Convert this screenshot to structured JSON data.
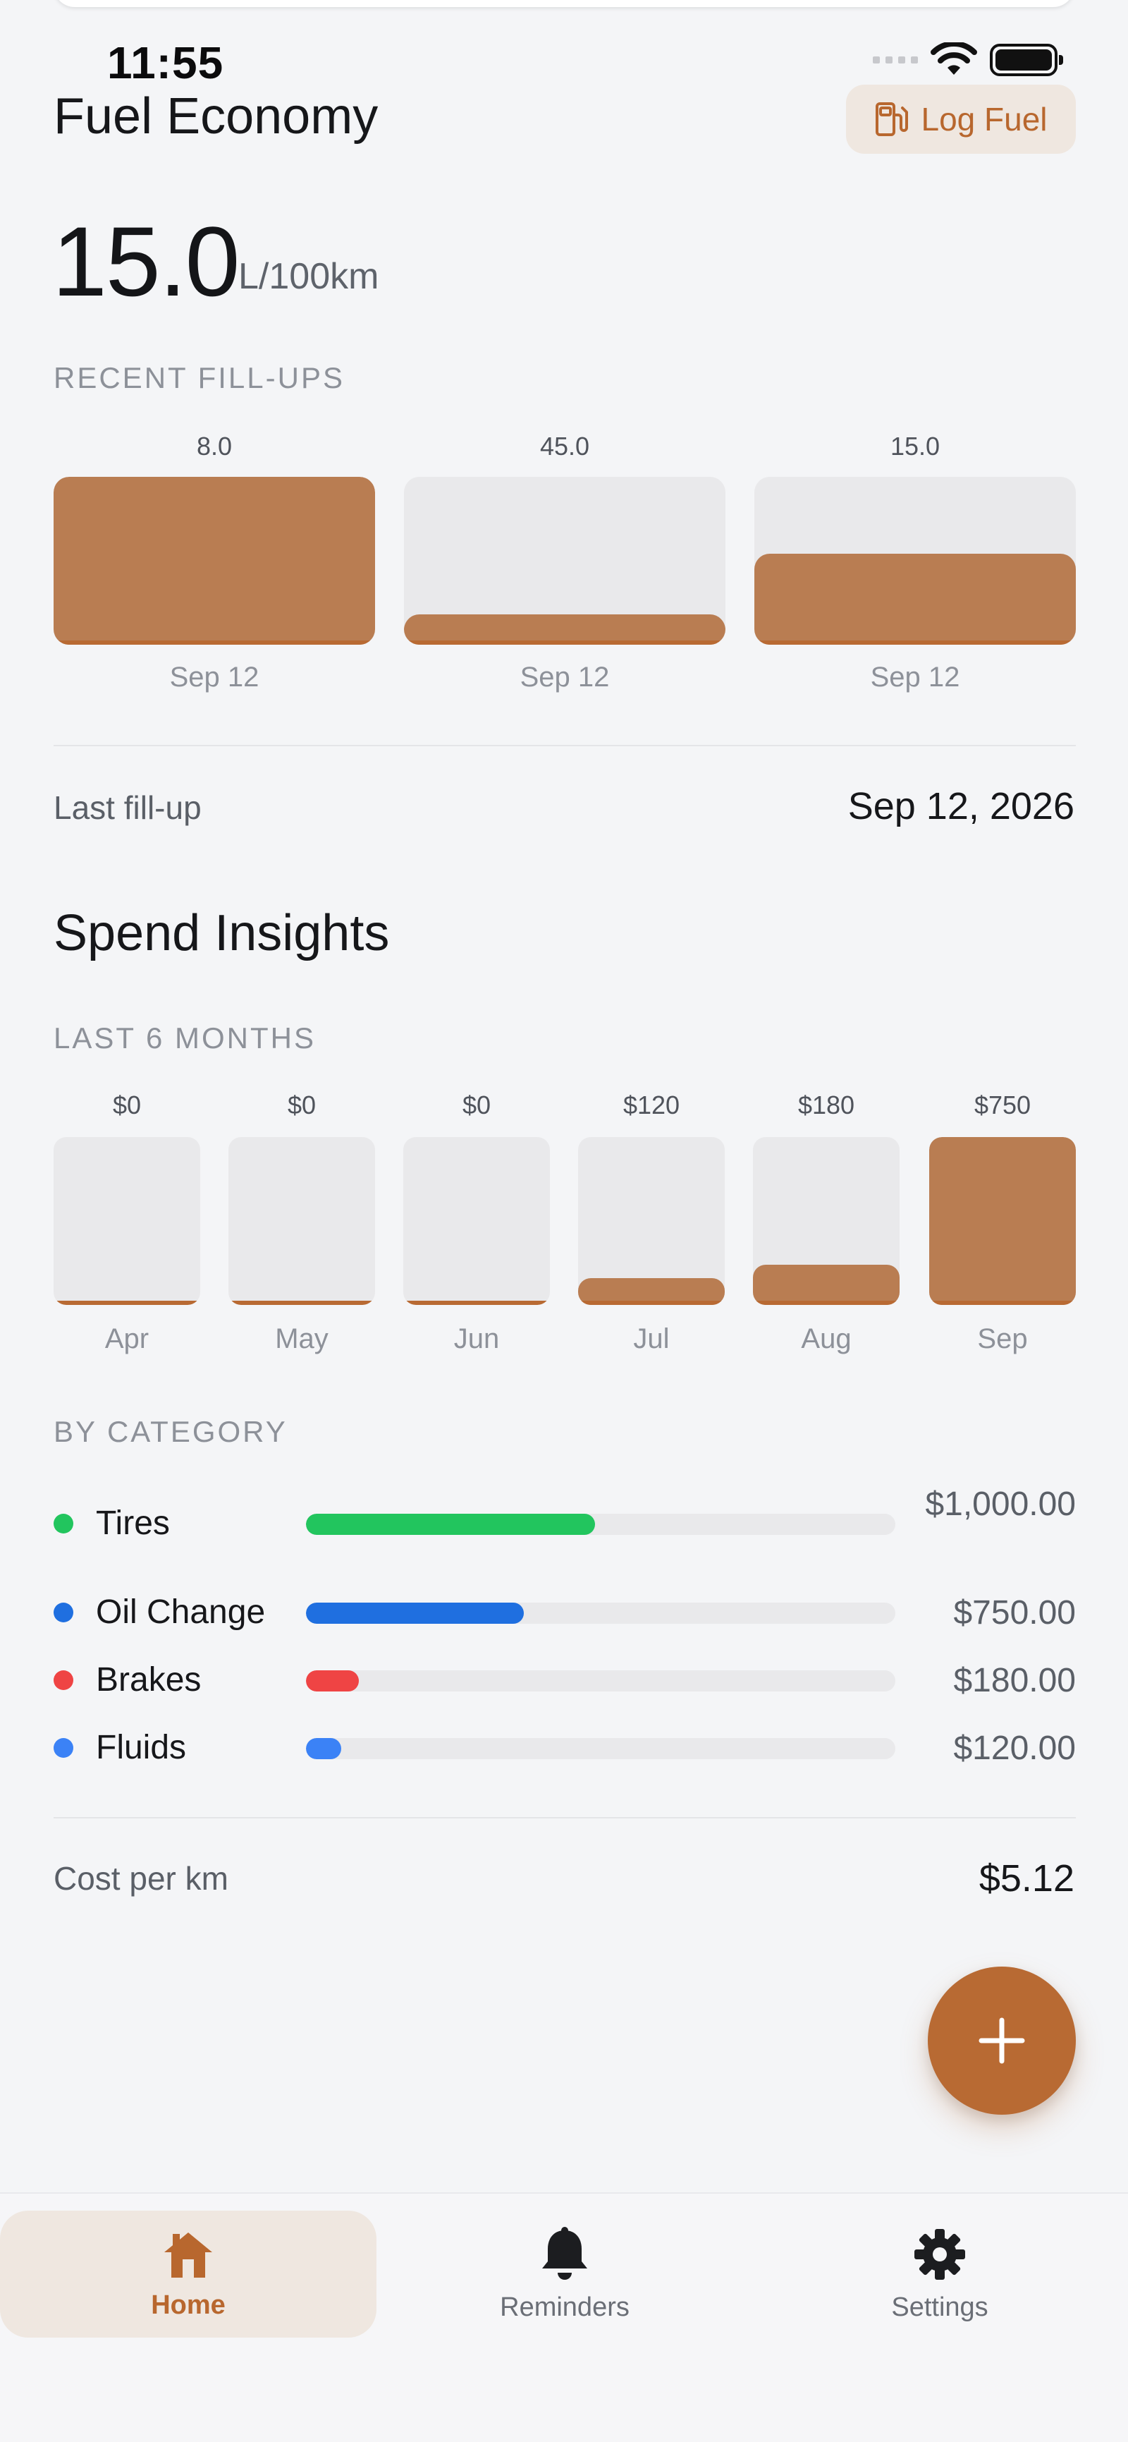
{
  "status_bar": {
    "time": "11:55"
  },
  "header": {
    "title": "Fuel Economy",
    "log_fuel_label": "Log Fuel"
  },
  "economy": {
    "value": "15.0",
    "unit": "L/100km"
  },
  "recent_fillups": {
    "label": "RECENT FILL-UPS",
    "items": [
      {
        "value": "8.0",
        "date": "Sep 12",
        "fill": 1.0
      },
      {
        "value": "45.0",
        "date": "Sep 12",
        "fill": 0.18
      },
      {
        "value": "15.0",
        "date": "Sep 12",
        "fill": 0.54
      }
    ]
  },
  "last_fillup": {
    "label": "Last fill-up",
    "value": "Sep 12, 2026"
  },
  "spend": {
    "title": "Spend Insights",
    "months_label": "LAST 6 MONTHS",
    "months": [
      {
        "value": "$0",
        "label": "Apr",
        "fill": 0.0
      },
      {
        "value": "$0",
        "label": "May",
        "fill": 0.0
      },
      {
        "value": "$0",
        "label": "Jun",
        "fill": 0.0
      },
      {
        "value": "$120",
        "label": "Jul",
        "fill": 0.16
      },
      {
        "value": "$180",
        "label": "Aug",
        "fill": 0.24
      },
      {
        "value": "$750",
        "label": "Sep",
        "fill": 1.0
      }
    ],
    "category_label": "BY CATEGORY",
    "categories": [
      {
        "name": "Tires",
        "amount": "$1,000.00",
        "fill": 0.49,
        "color": "#22c55e"
      },
      {
        "name": "Oil Change",
        "amount": "$750.00",
        "fill": 0.37,
        "color": "#1f6fe0"
      },
      {
        "name": "Brakes",
        "amount": "$180.00",
        "fill": 0.09,
        "color": "#ef4444"
      },
      {
        "name": "Fluids",
        "amount": "$120.00",
        "fill": 0.06,
        "color": "#3b82f6"
      }
    ]
  },
  "cost_per_km": {
    "label": "Cost per km",
    "value": "$5.12"
  },
  "nav": {
    "items": [
      {
        "label": "Home",
        "icon": "home-icon"
      },
      {
        "label": "Reminders",
        "icon": "bell-icon"
      },
      {
        "label": "Settings",
        "icon": "gear-icon"
      }
    ]
  }
}
